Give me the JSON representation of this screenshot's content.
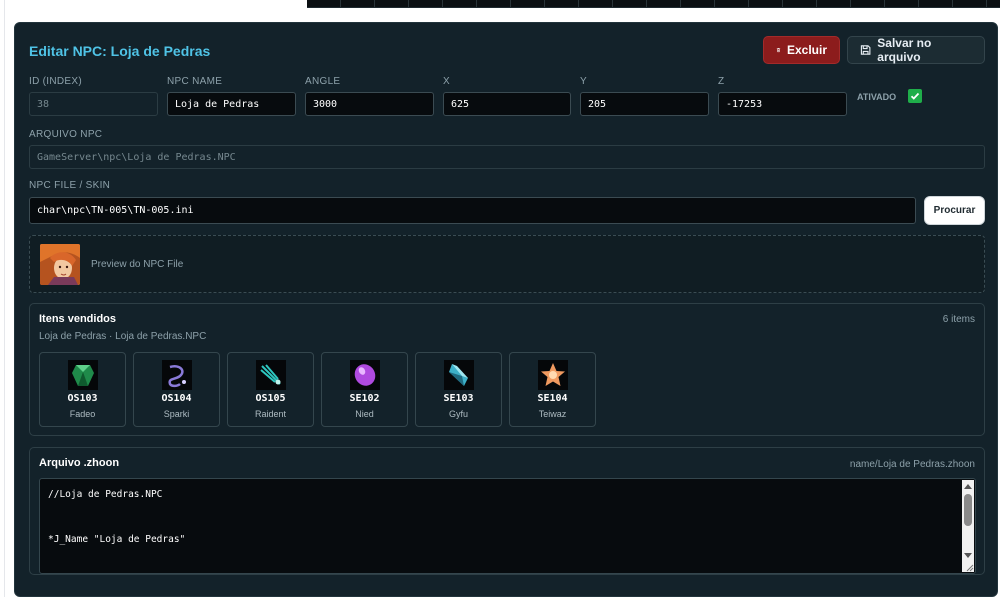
{
  "editor": {
    "title": "Editar NPC: Loja de Pedras",
    "delete_label": "Excluir",
    "save_label": "Salvar no arquivo"
  },
  "fields": {
    "id_label": "ID (INDEX)",
    "id_value": "38",
    "name_label": "NPC NAME",
    "name_value": "Loja de Pedras",
    "angle_label": "ANGLE",
    "angle_value": "3000",
    "x_label": "X",
    "x_value": "625",
    "y_label": "Y",
    "y_value": "205",
    "z_label": "Z",
    "z_value": "-17253",
    "ativado_label": "ATIVADO",
    "ativado_checked": true,
    "arquivo_label": "ARQUIVO NPC",
    "arquivo_value": "GameServer\\npc\\Loja de Pedras.NPC",
    "skin_label": "NPC FILE / SKIN",
    "skin_value": "char\\npc\\TN-005\\TN-005.ini",
    "procurar_label": "Procurar"
  },
  "preview": {
    "text": "Preview do NPC File"
  },
  "itens": {
    "title": "Itens vendidos",
    "subtitle": "Loja de Pedras · Loja de Pedras.NPC",
    "count": "6 items",
    "list": [
      {
        "code": "OS103",
        "name": "Fadeo",
        "icon": "green-gem-icon",
        "color": "#1f8a4a"
      },
      {
        "code": "OS104",
        "name": "Sparki",
        "icon": "purple-swirl-icon",
        "color": "#8a7ad8"
      },
      {
        "code": "OS105",
        "name": "Raident",
        "icon": "teal-bolt-icon",
        "color": "#2ec7c0"
      },
      {
        "code": "SE102",
        "name": "Nied",
        "icon": "purple-crystal-icon",
        "color": "#b04adf"
      },
      {
        "code": "SE103",
        "name": "Gyfu",
        "icon": "blue-crystal-icon",
        "color": "#3db0c8"
      },
      {
        "code": "SE104",
        "name": "Teiwaz",
        "icon": "orange-star-icon",
        "color": "#f09a60"
      }
    ]
  },
  "zhoon": {
    "title": "Arquivo .zhoon",
    "path": "name/Loja de Pedras.zhoon",
    "lines": [
      "//Loja de Pedras.NPC",
      "",
      "",
      "*J_Name \"Loja de Pedras\""
    ]
  },
  "colors": {
    "accent": "#4fc3e6",
    "danger": "#8c1c1c",
    "success": "#1fae4a",
    "panel": "#13222a"
  }
}
